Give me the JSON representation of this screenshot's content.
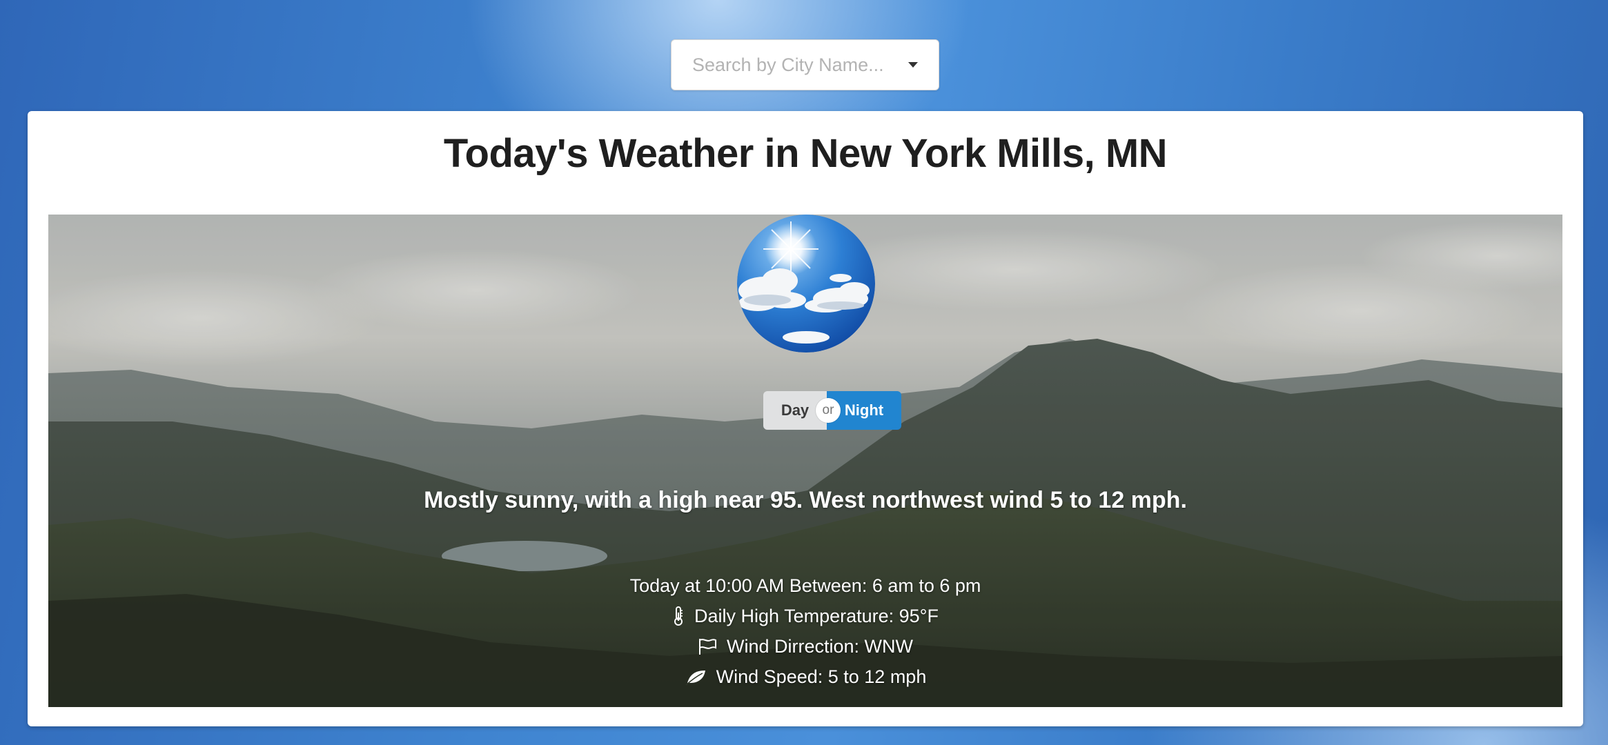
{
  "search": {
    "placeholder": "Search by City Name..."
  },
  "card": {
    "title": "Today's Weather in New York Mills, MN"
  },
  "toggle": {
    "day_label": "Day",
    "or_label": "or",
    "night_label": "Night",
    "active": "Night"
  },
  "forecast": {
    "summary": "Mostly sunny, with a high near 95. West northwest wind 5 to 12 mph."
  },
  "details": {
    "time": "Today at 10:00 AM Between: 6 am to 6 pm",
    "temperature": "Daily High  Temperature: 95°F",
    "wind_direction": "Wind Dirrection: WNW",
    "wind_speed": "Wind Speed: 5 to 12 mph"
  },
  "icons": {
    "weather": "sunny-sky-icon",
    "temperature": "thermometer-icon",
    "wind_direction": "flag-icon",
    "wind_speed": "leaf-icon"
  },
  "colors": {
    "night_button": "#2185d0",
    "day_button": "#e0e1e2"
  }
}
